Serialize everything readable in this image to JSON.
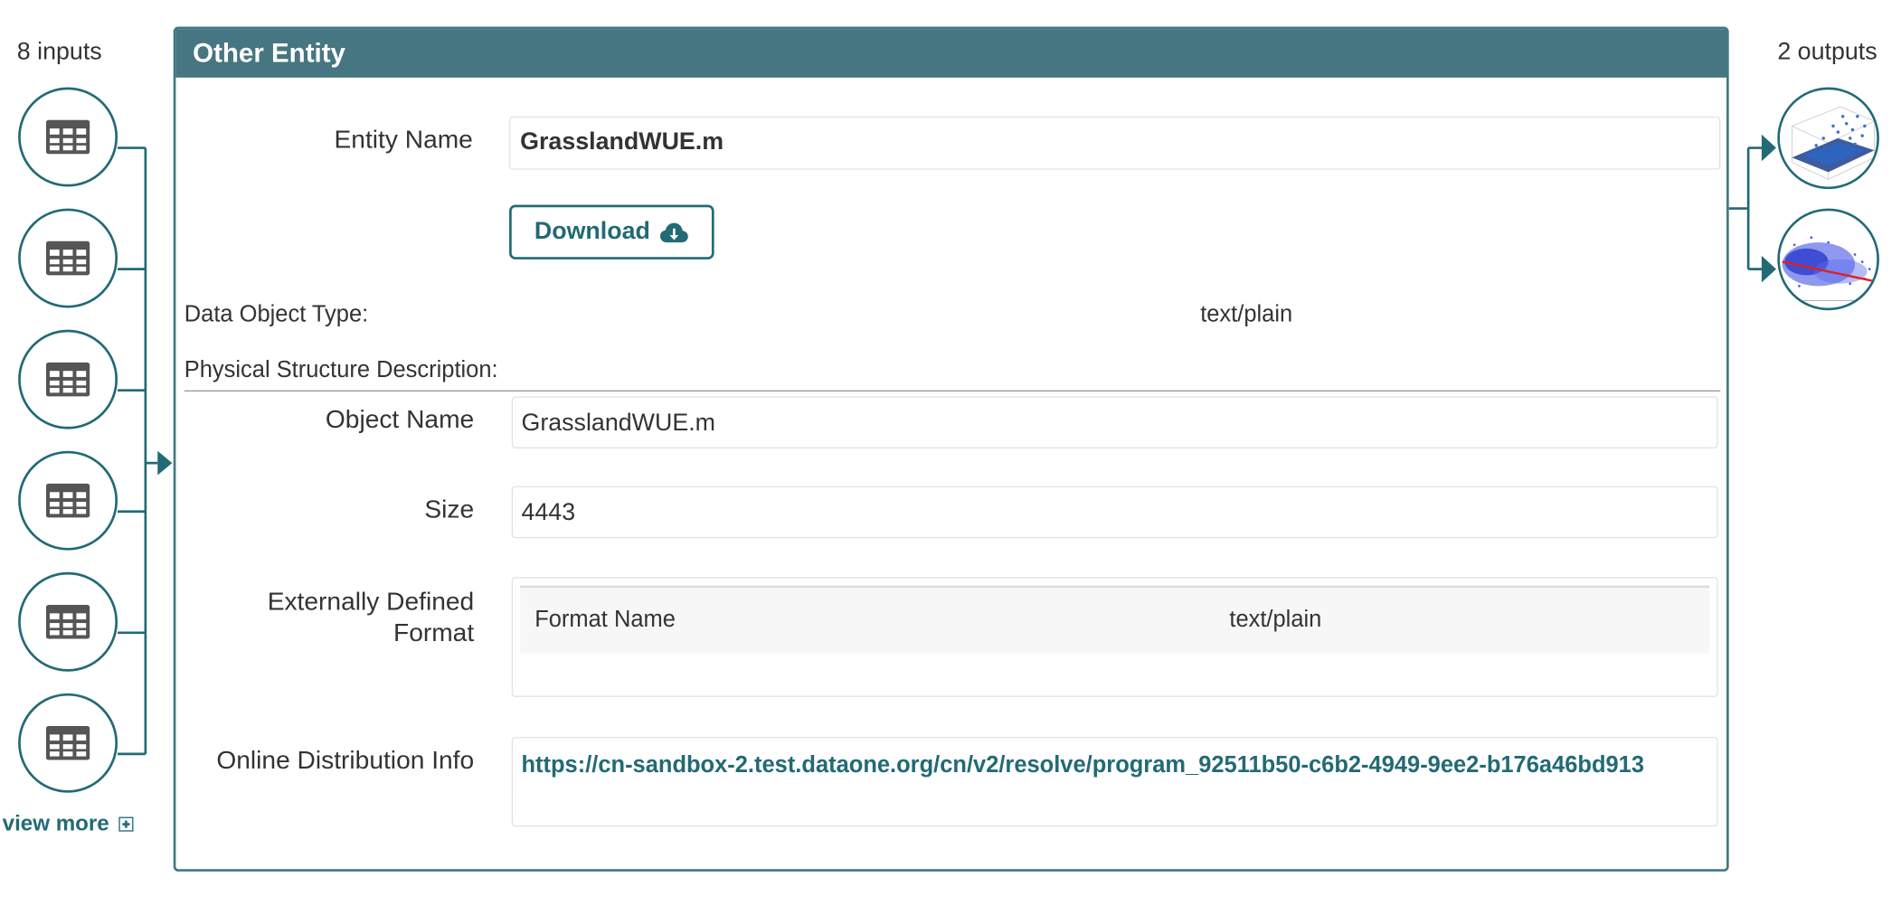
{
  "inputs": {
    "count_label": "8 inputs",
    "items": [
      {
        "icon": "table-icon"
      },
      {
        "icon": "table-icon"
      },
      {
        "icon": "table-icon"
      },
      {
        "icon": "table-icon"
      },
      {
        "icon": "table-icon"
      },
      {
        "icon": "table-icon"
      }
    ],
    "view_more_label": "view more"
  },
  "outputs": {
    "count_label": "2 outputs",
    "items": [
      {
        "icon": "3d-scatter-plot-thumbnail"
      },
      {
        "icon": "scatter-plot-thumbnail"
      }
    ]
  },
  "entity": {
    "header_title": "Other Entity",
    "entity_name_label": "Entity Name",
    "entity_name_value": "GrasslandWUE.m",
    "download_label": "Download",
    "data_object_type_label": "Data Object Type:",
    "data_object_type_value": "text/plain",
    "physical_structure_label": "Physical Structure Description:",
    "object_name_label": "Object Name",
    "object_name_value": "GrasslandWUE.m",
    "size_label": "Size",
    "size_value": "4443",
    "external_format_label_line1": "Externally Defined",
    "external_format_label_line2": "Format",
    "format_name_label": "Format Name",
    "format_name_value": "text/plain",
    "online_distribution_label": "Online Distribution Info",
    "online_distribution_url": "https://cn-sandbox-2.test.dataone.org/cn/v2/resolve/program_92511b50-c6b2-4949-9ee2-b176a46bd913"
  },
  "colors": {
    "accent": "#226a75",
    "header_bg": "#467681"
  }
}
